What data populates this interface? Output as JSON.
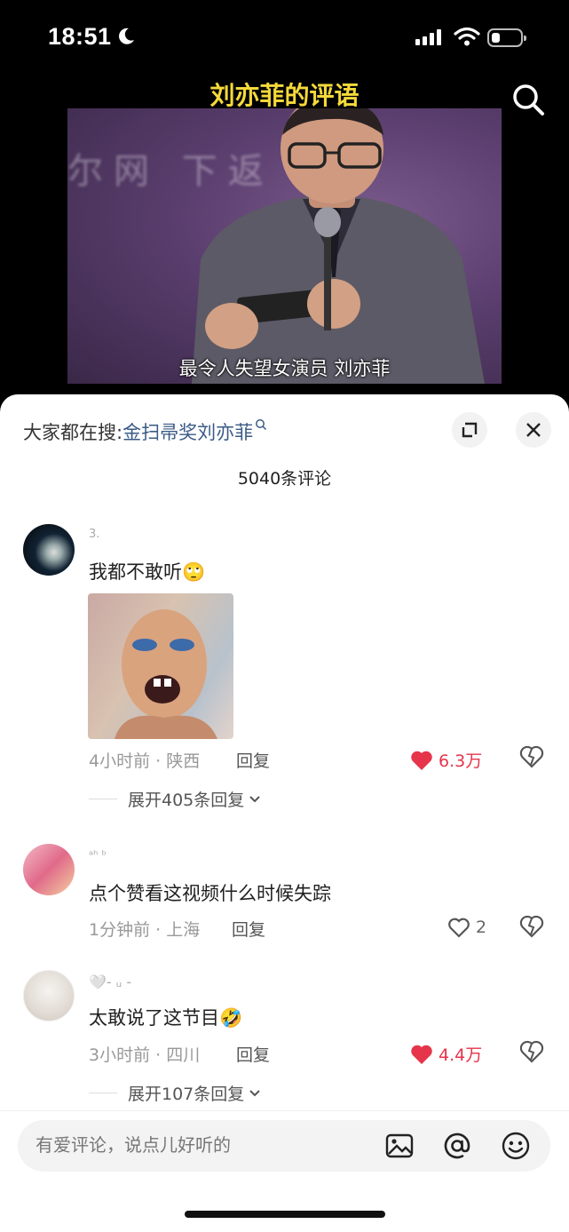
{
  "status_bar": {
    "time": "18:51"
  },
  "video": {
    "title": "刘亦菲的评语",
    "background_text": "尔网  下返",
    "subtitle": "最令人失望女演员 刘亦菲"
  },
  "comments_panel": {
    "trending_label": "大家都在搜:",
    "trending_query": "金扫帚奖刘亦菲",
    "comment_count": "5040条评论",
    "comments": [
      {
        "username": "3.",
        "text": "我都不敢听",
        "emoji": "🙄",
        "time_location": "4小时前 · 陕西",
        "reply_label": "回复",
        "likes": "6.3万",
        "liked": true,
        "expand": "展开405条回复"
      },
      {
        "username": "ᵃʰ ᵇ",
        "text": "点个赞看这视频什么时候失踪",
        "time_location": "1分钟前 · 上海",
        "reply_label": "回复",
        "likes": "2",
        "liked": false
      },
      {
        "username": "🤍- ᵤ -",
        "text": "太敢说了这节目",
        "emoji": "🤣",
        "time_location": "3小时前 · 四川",
        "reply_label": "回复",
        "likes": "4.4万",
        "liked": true,
        "expand": "展开107条回复"
      }
    ],
    "input_placeholder": "有爱评论，说点儿好听的"
  },
  "colors": {
    "video_title": "#f4d93a",
    "like_active": "#e6344b",
    "trending_query": "#3a5a86"
  }
}
